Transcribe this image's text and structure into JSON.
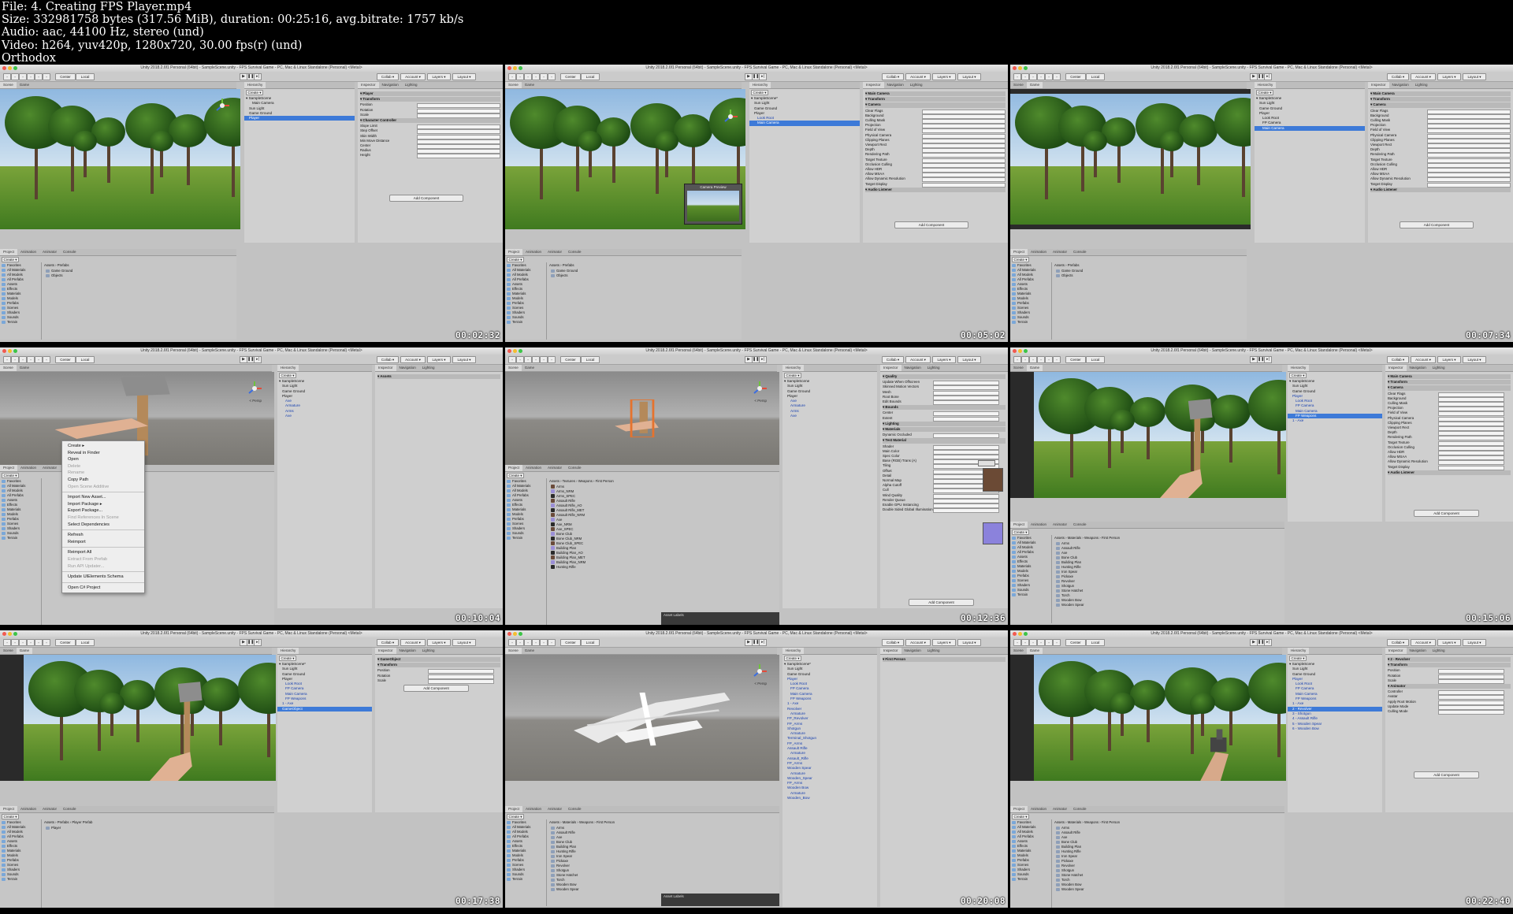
{
  "header": {
    "file": "File: 4. Creating FPS Player.mp4",
    "size": "Size: 332981758 bytes (317.56 MiB), duration: 00:25:16, avg.bitrate: 1757 kb/s",
    "audio": "Audio: aac, 44100 Hz, stereo (und)",
    "video": "Video: h264, yuv420p, 1280x720, 30.00 fps(r) (und)",
    "watermark": "Orthodox"
  },
  "editor": {
    "window_title": "Unity 2018.2.6f1 Personal (64bit) - SampleScene.unity - FPS Survival Game - PC, Mac & Linux Standalone (Personal) <Metal>",
    "toolbar": {
      "center": "Center",
      "local": "Local",
      "collab": "Collab",
      "account": "Account",
      "layers": "Layers",
      "layout": "Layout"
    },
    "tabs": {
      "scene": "Scene",
      "game": "Game",
      "hierarchy": "Hierarchy",
      "inspector": "Inspector",
      "navigation": "Navigation",
      "lighting": "Lighting",
      "project": "Project",
      "animation": "Animation",
      "animator": "Animator",
      "console": "Console",
      "create": "Create"
    },
    "add_component": "Add Component"
  },
  "tiles": [
    {
      "timestamp": "00:02:32",
      "hierarchy": [
        "SampleScene",
        "Main Camera",
        "Sun Light",
        "Game Ground",
        "Player"
      ],
      "inspector": [
        "Player",
        "Transform",
        "Position",
        "Rotation",
        "Scale",
        "Character Controller",
        "Slope Limit",
        "Step Offset",
        "Skin Width",
        "Min Move Distance",
        "Center",
        "Radius",
        "Height"
      ],
      "project": [
        "Favorites",
        "All Materials",
        "All Models",
        "All Prefabs",
        "Assets",
        "Effects",
        "Materials",
        "Models",
        "Prefabs",
        "Scenes",
        "Shaders",
        "Sounds",
        "Terrain"
      ],
      "breadcrumb": "Assets › Prefabs",
      "files": [
        "Game Ground",
        "Objects"
      ]
    },
    {
      "timestamp": "00:05:02",
      "hierarchy": [
        "SampleScene*",
        "Sun Light",
        "Game Ground",
        "Player",
        "Look Root",
        "Main Camera"
      ],
      "inspector": [
        "Main Camera",
        "Transform",
        "Camera",
        "Clear Flags",
        "Background",
        "Culling Mask",
        "Projection",
        "Field of View",
        "Physical Camera",
        "Clipping Planes",
        "Viewport Rect",
        "Depth",
        "Rendering Path",
        "Target Texture",
        "Occlusion Culling",
        "Allow HDR",
        "Allow MSAA",
        "Allow Dynamic Resolution",
        "Target Display",
        "Audio Listener"
      ],
      "preview": "Camera Preview"
    },
    {
      "timestamp": "00:07:34",
      "hierarchy": [
        "SampleScene",
        "Sun Light",
        "Game Ground",
        "Player",
        "Look Root",
        "FP Camera",
        "Main Camera"
      ],
      "inspector": [
        "Main Camera",
        "Transform",
        "Camera",
        "Clear Flags",
        "Background",
        "Culling Mask",
        "Projection",
        "Field of View",
        "Physical Camera",
        "Clipping Planes",
        "Viewport Rect",
        "Depth",
        "Rendering Path",
        "Target Texture",
        "Occlusion Culling",
        "Allow HDR",
        "Allow MSAA",
        "Allow Dynamic Resolution",
        "Target Display",
        "Audio Listener"
      ]
    },
    {
      "timestamp": "00:10:04",
      "hierarchy": [
        "SampleScene",
        "Sun Light",
        "Game Ground",
        "Player",
        "Axe",
        "Armature",
        "Arms",
        "Axe"
      ],
      "context_menu": [
        "Create",
        "Reveal in Finder",
        "Open",
        "Delete",
        "Rename",
        "Copy Path",
        "Open Scene Additive",
        "Import New Asset...",
        "Import Package",
        "Export Package...",
        "Find References In Scene",
        "Select Dependencies",
        "Refresh",
        "Reimport",
        "Reimport All",
        "Extract From Prefab",
        "Run API Updater...",
        "Update UIElements Schema",
        "Open C# Project"
      ],
      "inspector": [
        "Assets"
      ]
    },
    {
      "timestamp": "00:12:36",
      "hierarchy": [
        "SampleScene",
        "Sun Light",
        "Game Ground",
        "Player",
        "Axe",
        "Armature",
        "Arms",
        "Axe"
      ],
      "breadcrumb": "Assets › Textures › Weapons › First Person",
      "files": [
        "Arms",
        "Arms_NRM",
        "Arms_SPEC",
        "Assault Rifle",
        "Assault Rifle_AO",
        "Assault Rifle_MET",
        "Assault Rifle_NRM",
        "Axe",
        "Axe_NRM",
        "Axe_SPEC",
        "Bone Club",
        "Bone Club_NRM",
        "Bone Club_SPEC",
        "Building Plan",
        "Building Plan_AO",
        "Building Plan_MET",
        "Building Plan_NRM",
        "Hunting Rifle"
      ],
      "inspector": [
        "Quality",
        "Update When Offscreen",
        "Skinned Motion Vectors",
        "Mesh",
        "Root Bone",
        "Edit Bounds",
        "Bounds",
        "Center",
        "Extent",
        "Lighting",
        "Materials",
        "Dynamic Occluded",
        "Test Material",
        "Shader",
        "Main Color",
        "Spec Color",
        "Base (RGB) Trans (A)",
        "Tiling",
        "Offset",
        "Detail",
        "Normal Map",
        "Alpha Cutoff",
        "Cull",
        "Wind Quality",
        "Render Queue",
        "Enable GPU Instancing",
        "Double Sided Global Illumination"
      ],
      "labels": "Asset Labels"
    },
    {
      "timestamp": "00:15:06",
      "hierarchy": [
        "SampleScene",
        "Sun Light",
        "Game Ground",
        "Player",
        "Look Root",
        "FP Camera",
        "Main Camera",
        "FP Weapons",
        "1 - Axe"
      ],
      "files": [
        "Arms",
        "Assault Rifle",
        "Axe",
        "Bone Club",
        "Building Plan",
        "Hunting Rifle",
        "Iron Spear",
        "Pickaxe",
        "Revolver",
        "Shotgun",
        "Stone Hatchet",
        "Torch",
        "Wooden Bow",
        "Wooden Spear"
      ],
      "breadcrumb": "Assets › Materials › Weapons › First Person"
    },
    {
      "timestamp": "00:17:38",
      "hierarchy": [
        "SampleScene*",
        "Sun Light",
        "Game Ground",
        "Player",
        "Look Root",
        "FP Camera",
        "Main Camera",
        "FP Weapons",
        "1 - Axe",
        "GameObject"
      ],
      "inspector": [
        "GameObject",
        "Transform",
        "Position",
        "Rotation",
        "Scale"
      ],
      "breadcrumb": "Assets › Prefabs › Player Prefab",
      "files": [
        "Player"
      ]
    },
    {
      "timestamp": "00:20:08",
      "hierarchy": [
        "SampleScene*",
        "Sun Light",
        "Game Ground",
        "Player",
        "Look Root",
        "FP Camera",
        "Main Camera",
        "FP Weapons",
        "1 - Axe",
        "Revolver",
        "Armature",
        "FP_Revolver",
        "FP_Arms",
        "Shotgun",
        "Armature",
        "Terminal_Shotgun",
        "FP_Arms",
        "Assault Rifle",
        "Armature",
        "Assault_Rifle",
        "FP_Arms",
        "Wooden Spear",
        "Armature",
        "Wooden_Spear",
        "FP_Arms",
        "Wooden Bow",
        "Armature",
        "Wooden_Bow"
      ],
      "inspector": [
        "First Person"
      ],
      "breadcrumb": "Assets › Materials › Weapons › First Person",
      "files": [
        "Arms",
        "Assault Rifle",
        "Axe",
        "Bone Club",
        "Building Plan",
        "Hunting Rifle",
        "Iron Spear",
        "Pickaxe",
        "Revolver",
        "Shotgun",
        "Stone Hatchet",
        "Torch",
        "Wooden Bow",
        "Wooden Spear"
      ],
      "labels": "Asset Labels"
    },
    {
      "timestamp": "00:22:40",
      "hierarchy": [
        "SampleScene",
        "Sun Light",
        "Game Ground",
        "Player",
        "Look Root",
        "FP Camera",
        "Main Camera",
        "FP Weapons",
        "1 - Axe",
        "2 - Revolver",
        "3 - Shotgun",
        "4 - Assault Rifle",
        "5 - Wooden Spear",
        "6 - Wooden Bow"
      ],
      "inspector": [
        "2 - Revolver",
        "Transform",
        "Position",
        "Rotation",
        "Scale",
        "Animator",
        "Controller",
        "Avatar",
        "Apply Root Motion",
        "Update Mode",
        "Culling Mode"
      ],
      "files": [
        "Arms",
        "Assault Rifle",
        "Axe",
        "Bone Club",
        "Building Plan",
        "Hunting Rifle",
        "Iron Spear",
        "Pickaxe",
        "Revolver",
        "Shotgun",
        "Stone Hatchet",
        "Torch",
        "Wooden Bow",
        "Wooden Spear"
      ]
    }
  ]
}
